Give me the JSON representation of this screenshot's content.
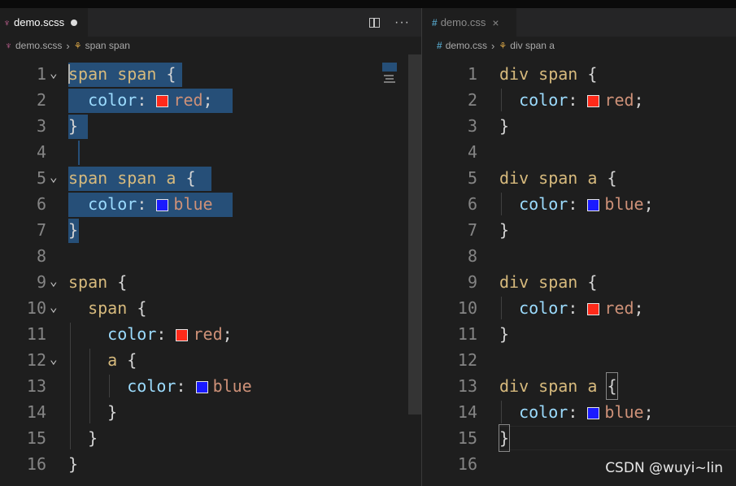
{
  "left": {
    "tab": {
      "icon": "scss-file-icon",
      "name": "demo.scss",
      "dirty": true
    },
    "breadcrumb": {
      "file": "demo.scss",
      "symbol": "span span"
    },
    "lines": [
      {
        "n": "1",
        "text": "span span {",
        "fold": true
      },
      {
        "n": "2",
        "text": "  color: red;",
        "fold": false
      },
      {
        "n": "3",
        "text": "}",
        "fold": false
      },
      {
        "n": "4",
        "text": "",
        "fold": false
      },
      {
        "n": "5",
        "text": "span span a {",
        "fold": true
      },
      {
        "n": "6",
        "text": "  color: blue",
        "fold": false
      },
      {
        "n": "7",
        "text": "}",
        "fold": false
      },
      {
        "n": "8",
        "text": "",
        "fold": false
      },
      {
        "n": "9",
        "text": "span {",
        "fold": true
      },
      {
        "n": "10",
        "text": "  span {",
        "fold": true
      },
      {
        "n": "11",
        "text": "    color: red;",
        "fold": false
      },
      {
        "n": "12",
        "text": "    a {",
        "fold": true
      },
      {
        "n": "13",
        "text": "      color: blue",
        "fold": false
      },
      {
        "n": "14",
        "text": "    }",
        "fold": false
      },
      {
        "n": "15",
        "text": "  }",
        "fold": false
      },
      {
        "n": "16",
        "text": "}",
        "fold": false
      }
    ]
  },
  "right": {
    "tab": {
      "icon": "css-file-icon",
      "name": "demo.css",
      "close": "×"
    },
    "breadcrumb": {
      "file": "demo.css",
      "symbol": "div span a"
    },
    "lines": [
      {
        "n": "1",
        "text": "div span {"
      },
      {
        "n": "2",
        "text": "  color: red;"
      },
      {
        "n": "3",
        "text": "}"
      },
      {
        "n": "4",
        "text": ""
      },
      {
        "n": "5",
        "text": "div span a {"
      },
      {
        "n": "6",
        "text": "  color: blue;"
      },
      {
        "n": "7",
        "text": "}"
      },
      {
        "n": "8",
        "text": ""
      },
      {
        "n": "9",
        "text": "div span {"
      },
      {
        "n": "10",
        "text": "  color: red;"
      },
      {
        "n": "11",
        "text": "}"
      },
      {
        "n": "12",
        "text": ""
      },
      {
        "n": "13",
        "text": "div span a {"
      },
      {
        "n": "14",
        "text": "  color: blue;"
      },
      {
        "n": "15",
        "text": "}"
      },
      {
        "n": "16",
        "text": ""
      }
    ]
  },
  "watermark": "CSDN @wuyi~lin",
  "colors": {
    "selector": "#d7ba7d",
    "property": "#9cdcfe",
    "value": "#ce9178",
    "selection": "#264f78",
    "swatch_red": "#ff2a1a",
    "swatch_blue": "#1a1aff"
  }
}
